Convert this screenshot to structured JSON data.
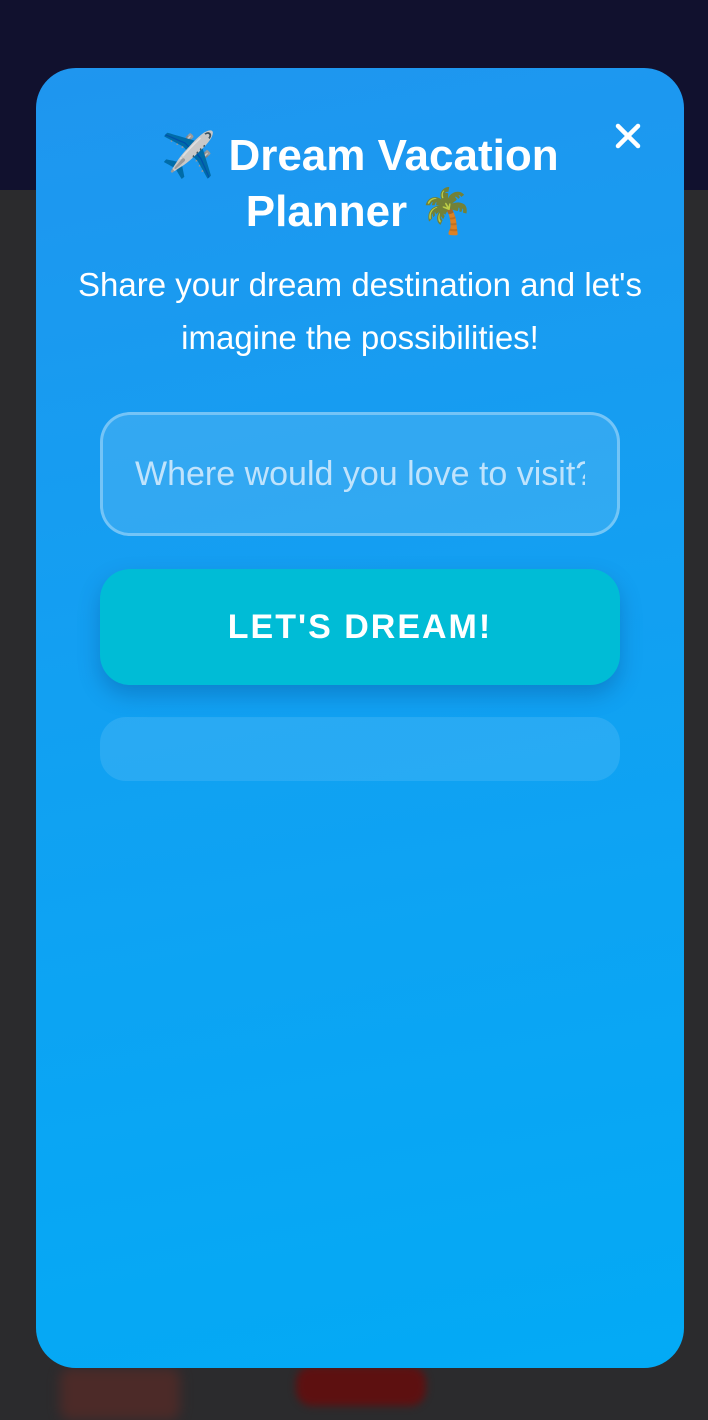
{
  "modal": {
    "title_plane_icon": "✈️",
    "title_text": "Dream Vacation Planner",
    "title_palm_icon": "🌴",
    "subtitle": "Share your dream destination and let's imagine the possibilities!",
    "close_icon": "close-icon",
    "destination_input": {
      "placeholder": "Where would you love to visit?",
      "value": ""
    },
    "submit_label": "LET'S DREAM!",
    "result_text": ""
  },
  "colors": {
    "modal_gradient_top": "#1f96ef",
    "modal_gradient_bottom": "#03aaf5",
    "button": "#00bcd6",
    "header_bg": "#11112e",
    "page_bg": "#2b2b2d"
  }
}
